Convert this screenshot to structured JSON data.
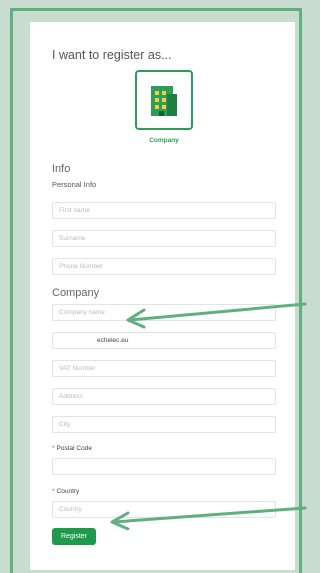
{
  "heading": "I want to register as...",
  "company_tile": {
    "label": "Company"
  },
  "sections": {
    "info": "Info",
    "personal_info": "Personal Info",
    "company": "Company"
  },
  "fields": {
    "first_name": {
      "placeholder": "First name"
    },
    "surname": {
      "placeholder": "Surname"
    },
    "phone": {
      "placeholder": "Phone Number"
    },
    "company_name": {
      "placeholder": "Company name"
    },
    "website": {
      "value": "echelec.eu"
    },
    "vat": {
      "placeholder": "VAT Number"
    },
    "address": {
      "placeholder": "Address"
    },
    "city": {
      "placeholder": "City"
    },
    "postal_code": {
      "label": "Postal Code",
      "value": ""
    },
    "country": {
      "label": "Country",
      "placeholder": "Country"
    }
  },
  "register_label": "Register",
  "colors": {
    "accent": "#1f9a4c",
    "arrow": "#5fb07f",
    "required": "#d9534f"
  }
}
